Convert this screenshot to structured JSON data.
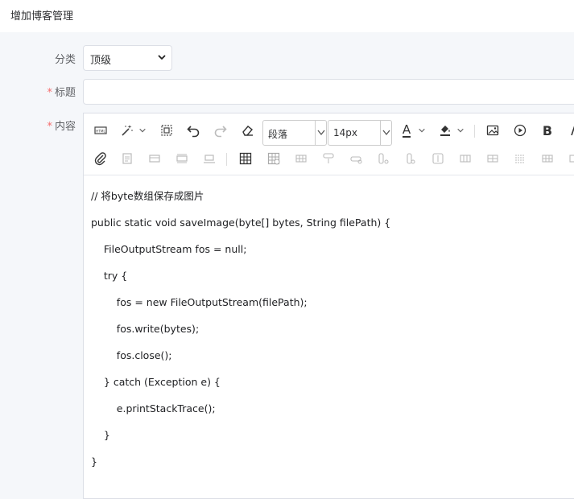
{
  "header": {
    "title": "增加博客管理"
  },
  "form": {
    "category": {
      "label": "分类",
      "value": "顶级"
    },
    "title": {
      "label": "标题",
      "required_mark": "*",
      "value": ""
    },
    "content": {
      "label": "内容",
      "required_mark": "*"
    }
  },
  "toolbar": {
    "paragraph_select": "段落",
    "font_size_select": "14px",
    "bold_label": "B",
    "font_color_label": "A"
  },
  "editor": {
    "lines": [
      "// 将byte数组保存成图片",
      "public static void saveImage(byte[] bytes, String filePath) {",
      "    FileOutputStream fos = null;",
      "    try {",
      "        fos = new FileOutputStream(filePath);",
      "        fos.write(bytes);",
      "        fos.close();",
      "    } catch (Exception e) {",
      "        e.printStackTrace();",
      "    }",
      "}"
    ]
  }
}
